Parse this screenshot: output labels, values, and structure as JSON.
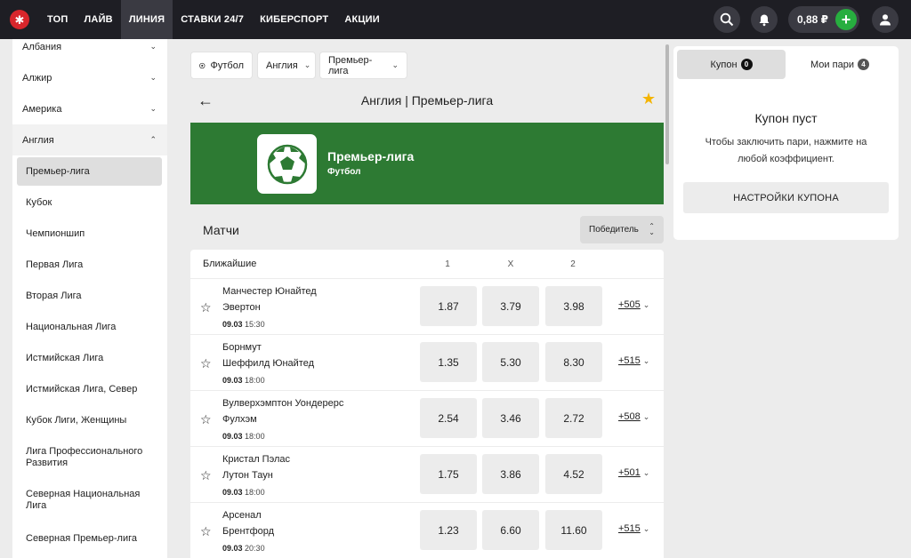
{
  "header": {
    "nav": [
      "ТОП",
      "ЛАЙВ",
      "ЛИНИЯ",
      "СТАВКИ 24/7",
      "КИБЕРСПОРТ",
      "АКЦИИ"
    ],
    "active_nav": "ЛИНИЯ",
    "balance": "0,88 ₽",
    "plus": "+",
    "icons": [
      "search-icon",
      "bell-icon",
      "user-icon"
    ]
  },
  "sidebar": {
    "countries": [
      "Албания",
      "Алжир",
      "Америка"
    ],
    "open_country": "Англия",
    "leagues": [
      "Премьер-лига",
      "Кубок",
      "Чемпионшип",
      "Первая Лига",
      "Вторая Лига",
      "Национальная Лига",
      "Истмийская Лига",
      "Истмийская Лига, Север",
      "Кубок Лиги, Женщины",
      "Лига Профессионального Развития",
      "Северная Национальная Лига",
      "Северная Премьер-лига"
    ],
    "active_league": "Премьер-лига"
  },
  "breadcrumbs": {
    "sport": "Футбол",
    "country": "Англия",
    "league": "Премьер-лига"
  },
  "page": {
    "title": "Англия | Премьер-лига"
  },
  "banner": {
    "name": "Премьер-лига",
    "sport": "Футбол",
    "color": "#2d7a33"
  },
  "matches": {
    "title": "Матчи",
    "sort": "Победитель",
    "header": {
      "label": "Ближайшие",
      "col1": "1",
      "colx": "X",
      "col2": "2"
    },
    "rows": [
      {
        "home": "Манчестер Юнайтед",
        "away": "Эвертон",
        "date": "09.03",
        "time": "15:30",
        "o1": "1.87",
        "ox": "3.79",
        "o2": "3.98",
        "more": "+505"
      },
      {
        "home": "Борнмут",
        "away": "Шеффилд Юнайтед",
        "date": "09.03",
        "time": "18:00",
        "o1": "1.35",
        "ox": "5.30",
        "o2": "8.30",
        "more": "+515"
      },
      {
        "home": "Вулверхэмптон Уондерерс",
        "away": "Фулхэм",
        "date": "09.03",
        "time": "18:00",
        "o1": "2.54",
        "ox": "3.46",
        "o2": "2.72",
        "more": "+508"
      },
      {
        "home": "Кристал Пэлас",
        "away": "Лутон Таун",
        "date": "09.03",
        "time": "18:00",
        "o1": "1.75",
        "ox": "3.86",
        "o2": "4.52",
        "more": "+501"
      },
      {
        "home": "Арсенал",
        "away": "Брентфорд",
        "date": "09.03",
        "time": "20:30",
        "o1": "1.23",
        "ox": "6.60",
        "o2": "11.60",
        "more": "+515"
      }
    ]
  },
  "coupon": {
    "tab_coupon": "Купон",
    "tab_coupon_count": "0",
    "tab_bets": "Мои пари",
    "tab_bets_count": "4",
    "empty_title": "Купон пуст",
    "empty_hint": "Чтобы заключить пари, нажмите на любой коэффициент.",
    "settings_button": "НАСТРОЙКИ КУПОНА"
  },
  "colors": {
    "topbar": "#1e1e24",
    "brand_red": "#d8262c",
    "plus_green": "#27ae3f",
    "favorite": "#f4b400"
  }
}
